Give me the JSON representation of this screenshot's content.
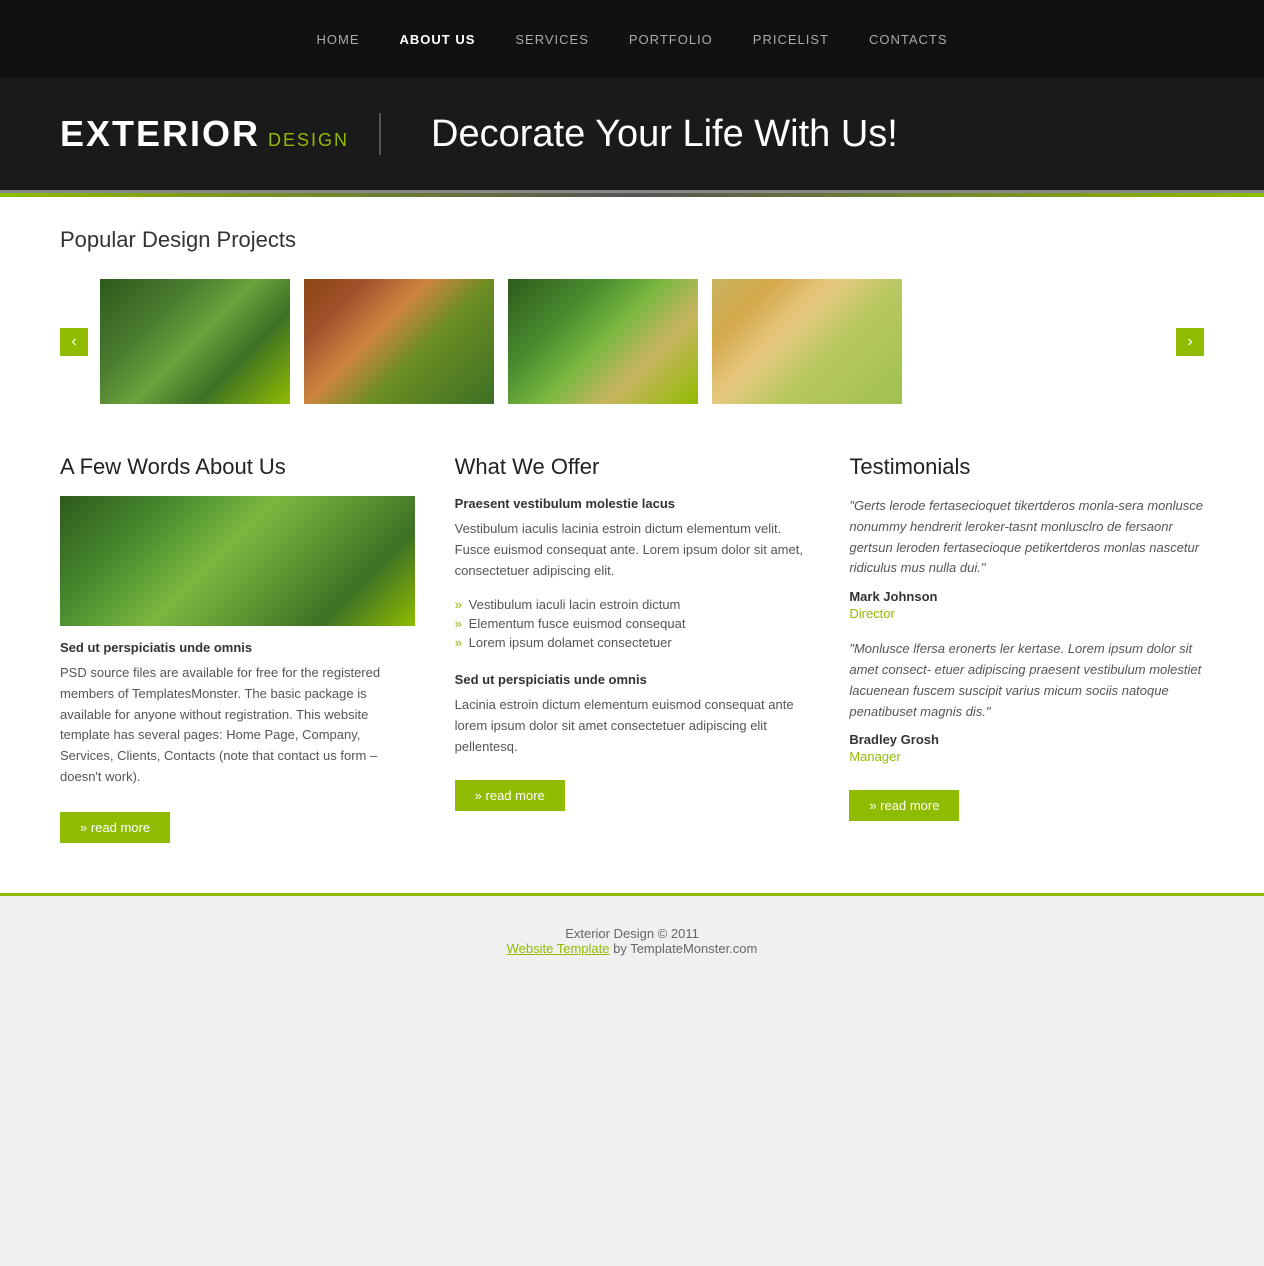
{
  "nav": {
    "items": [
      {
        "label": "HOME",
        "active": false
      },
      {
        "label": "ABOUT US",
        "active": true
      },
      {
        "label": "SERVICES",
        "active": false
      },
      {
        "label": "PORTFOLIO",
        "active": false
      },
      {
        "label": "PRICELIST",
        "active": false
      },
      {
        "label": "CONTACTS",
        "active": false
      }
    ]
  },
  "hero": {
    "logo_main": "EXTERIOR",
    "logo_sub": "DESIGN",
    "tagline": "Decorate Your Life With Us!"
  },
  "projects": {
    "title": "Popular Design Projects"
  },
  "carousel": {
    "prev_label": "‹",
    "next_label": "›"
  },
  "about": {
    "title": "A Few Words About Us",
    "subtitle": "Sed ut perspiciatis unde omnis",
    "text": "PSD source files are available for free for the registered members of TemplatesMonster. The basic package is available for anyone without registration. This website template has several pages: Home Page, Company, Services, Clients, Contacts (note that contact us form – doesn't work).",
    "read_more": "» read more"
  },
  "offer": {
    "title": "What We Offer",
    "bold1": "Praesent vestibulum molestie lacus",
    "text1": "Vestibulum iaculis lacinia estroin dictum elementum velit. Fusce euismod consequat ante. Lorem ipsum dolor sit amet, consectetuer adipiscing elit.",
    "list": [
      "Vestibulum iaculi lacin estroin dictum",
      "Elementum fusce euismod consequat",
      "Lorem ipsum dolamet consectetuer"
    ],
    "bold2": "Sed ut perspiciatis unde omnis",
    "text2": "Lacinia estroin dictum elementum euismod consequat ante lorem ipsum dolor sit amet consectetuer adipiscing elit pellentesq.",
    "read_more": "» read more"
  },
  "testimonials": {
    "title": "Testimonials",
    "items": [
      {
        "quote": "\"Gerts lerode fertasecioquet tikertderos monla-sera monlusce nonummy hendrerit leroker-tasnt monlusclro de fersaonr gertsun leroden fertasecioque petikertderos monlas nascetur ridiculus mus nulla dui.\"",
        "name": "Mark Johnson",
        "role": "Director"
      },
      {
        "quote": "\"Monlusce lfersa eronerts ler kertase. Lorem ipsum dolor sit amet consect- etuer adipiscing praesent vestibulum molestiet lacuenean fuscem suscipit varius micum sociis natoque penatibuset magnis dis.\"",
        "name": "Bradley Grosh",
        "role": "Manager"
      }
    ],
    "read_more": "» read more"
  },
  "footer": {
    "copyright": "Exterior Design © 2011",
    "link_text": "Website Template",
    "suffix": " by TemplateMonster.com"
  }
}
